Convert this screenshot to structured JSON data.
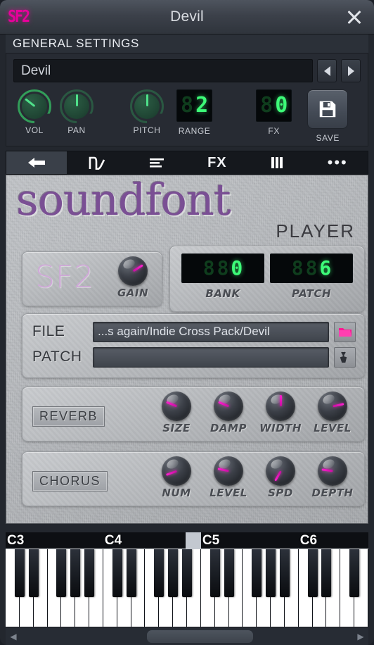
{
  "window": {
    "title": "Devil",
    "logo": "SF2",
    "close_icon": "close-icon"
  },
  "general": {
    "header": "GENERAL SETTINGS",
    "preset_name": "Devil",
    "prev_label": "◀",
    "next_label": "▶",
    "knobs": [
      {
        "label": "VOL",
        "angle": -52
      },
      {
        "label": "PAN",
        "angle": 0
      },
      {
        "label": "PITCH",
        "angle": 0
      }
    ],
    "range": {
      "label": "RANGE",
      "value": "2",
      "digits": 2
    },
    "fx": {
      "label": "FX",
      "value": "0",
      "digits": 2
    },
    "save": {
      "label": "SAVE",
      "icon": "floppy-disk-icon"
    }
  },
  "tabs": [
    {
      "name": "tab-plugin",
      "icon": "plug-icon",
      "label": "",
      "active": true
    },
    {
      "name": "tab-envelope",
      "icon": "envelope-curve-icon",
      "label": "",
      "active": false
    },
    {
      "name": "tab-levels",
      "icon": "levels-icon",
      "label": "",
      "active": false
    },
    {
      "name": "tab-fx",
      "icon": "fx-text-icon",
      "label": "FX",
      "active": false
    },
    {
      "name": "tab-keyboard",
      "icon": "keyboard-icon",
      "label": "",
      "active": false
    },
    {
      "name": "tab-more",
      "icon": "ellipsis-icon",
      "label": "•••",
      "active": false
    }
  ],
  "soundfont": {
    "title": "soundfont",
    "subtitle": "PLAYER",
    "sf2_logo": "SF2",
    "gain": {
      "label": "GAIN",
      "angle": 58
    },
    "bank": {
      "label": "BANK",
      "value": "0",
      "digits": 3
    },
    "patch": {
      "label": "PATCH",
      "value": "6",
      "digits": 3
    },
    "file": {
      "label": "FILE",
      "value": "...s again/Indie Cross Pack/Devil",
      "button_icon": "folder-icon"
    },
    "patch_row": {
      "label": "PATCH",
      "value": "",
      "button_icon": "wrench-icon"
    },
    "reverb": {
      "tag": "REVERB",
      "knobs": [
        {
          "label": "SIZE",
          "angle": -68
        },
        {
          "label": "DAMP",
          "angle": -68
        },
        {
          "label": "WIDTH",
          "angle": 0
        },
        {
          "label": "LEVEL",
          "angle": 78
        }
      ]
    },
    "chorus": {
      "tag": "CHORUS",
      "knobs": [
        {
          "label": "NUM",
          "angle": -110
        },
        {
          "label": "LEVEL",
          "angle": -78
        },
        {
          "label": "SPD",
          "angle": -150
        },
        {
          "label": "DEPTH",
          "angle": -82
        }
      ]
    }
  },
  "keyboard": {
    "octave_labels": [
      "C3",
      "C4",
      "C5",
      "C6"
    ],
    "marker_label": "octave-scroll-marker",
    "scroll_left": "◀",
    "scroll_right": "▶"
  },
  "colors": {
    "accent_magenta": "#e8009b",
    "led_green": "#3dfb78",
    "panel_purple": "#7a4f94",
    "titlebar": "#3c414a"
  }
}
